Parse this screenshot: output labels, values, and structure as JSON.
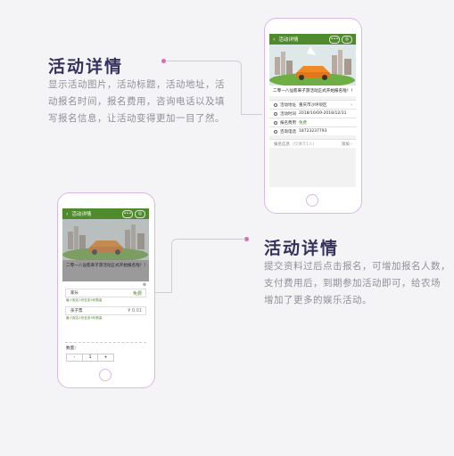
{
  "section1": {
    "title": "活动详情",
    "description_lines": [
      "显示活动图片，活动标题，活动地址，活",
      "动报名时间，报名费用，咨询电话以及填",
      "写报名信息，让活动变得更加一目了然。"
    ]
  },
  "section2": {
    "title": "活动详情",
    "description_lines": [
      "提交资料过后点击报名，可增加报名人数，",
      "支付费用后，到期参加活动即可，给农场",
      "增加了更多的娱乐活动。"
    ]
  },
  "phone1": {
    "nav_title": "活动详情",
    "back_icon": "‹",
    "menu_icon": "•••",
    "close_icon": "◎",
    "event_title": "二零一八仙客来子游活动正式开始报名啦！！",
    "rows": [
      {
        "icon": "location-icon",
        "label": "活动地址",
        "value": "重庆市沙坪坝区",
        "arrow": "›"
      },
      {
        "icon": "clock-icon",
        "label": "活动时间",
        "value": "2018/10/09-2018/12/31",
        "arrow": ""
      },
      {
        "icon": "fee-icon",
        "label": "报名费用",
        "value": "免费",
        "arrow": ""
      },
      {
        "icon": "phone-icon",
        "label": "咨询电话",
        "value": "18723237793",
        "arrow": ""
      }
    ],
    "signup_label": "报名信息",
    "signup_hint": "(仅填写1人)",
    "signup_link": "添加 ›"
  },
  "phone2": {
    "nav_title": "活动详情",
    "back_icon": "‹",
    "menu_icon": "•••",
    "close_icon": "◎",
    "event_title": "二零一八仙客来子游活动正式开始报名啦！！",
    "close_x": "⊗",
    "fields": [
      {
        "label": "家长",
        "value": "免费",
        "note": "最少报名1份至多5份数量"
      },
      {
        "label": "孩子票",
        "value": "¥ 0.01",
        "note": "最少报名1份至多5份数量"
      }
    ],
    "quantity_label": "数量：",
    "stepper_minus": "-",
    "stepper_value": "1",
    "stepper_plus": "+"
  },
  "colors": {
    "accent": "#4f8a2d",
    "title": "#35315f",
    "phone_border": "#dab7e6",
    "dot": "#e06ab0"
  }
}
